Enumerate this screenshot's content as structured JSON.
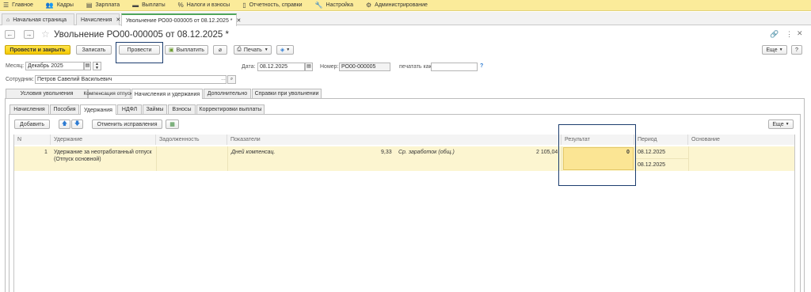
{
  "menu": [
    {
      "icon": "home-icon",
      "glyph": "☰",
      "label": "Главное"
    },
    {
      "icon": "staff-icon",
      "glyph": "👥",
      "label": "Кадры"
    },
    {
      "icon": "salary-icon",
      "glyph": "▤",
      "label": "Зарплата"
    },
    {
      "icon": "payments-icon",
      "glyph": "▬",
      "label": "Выплаты"
    },
    {
      "icon": "percent-icon",
      "glyph": "%",
      "label": "Налоги и взносы"
    },
    {
      "icon": "reports-icon",
      "glyph": "▯",
      "label": "Отчетность, справки"
    },
    {
      "icon": "wrench-icon",
      "glyph": "🔧",
      "label": "Настройка"
    },
    {
      "icon": "gear-icon",
      "glyph": "⚙",
      "label": "Администрирование"
    }
  ],
  "tabs": [
    {
      "label": "Начальная страница",
      "closable": false
    },
    {
      "label": "Начисления",
      "closable": true
    },
    {
      "label": "Увольнение РО00-000005 от 08.12.2025 *",
      "closable": true
    }
  ],
  "document": {
    "title": "Увольнение РО00-000005 от 08.12.2025 *"
  },
  "toolbar": {
    "post_close": "Провести и закрыть",
    "save": "Записать",
    "post": "Провести",
    "pay": "Выплатить",
    "print": "Печать",
    "more": "Еще"
  },
  "form": {
    "month_label": "Месяц:",
    "month_value": "Декабрь 2025",
    "date_label": "Дата:",
    "date_value": "08.12.2025",
    "number_label": "Номер:",
    "number_value": "РО00-000005",
    "print_as_label": "печатать как:",
    "print_as_value": "",
    "employee_label": "Сотрудник:",
    "employee_value": "Петров Савелий Васильевич"
  },
  "tabs_level1": [
    "Условия увольнения",
    "Компенсация отпуска",
    "Начисления и удержания",
    "Дополнительно",
    "Справки при увольнении"
  ],
  "tabs_level2": [
    "Начисления",
    "Пособия",
    "Удержания",
    "НДФЛ",
    "Займы",
    "Взносы",
    "Корректировки выплаты"
  ],
  "grid_toolbar": {
    "add": "Добавить",
    "cancel_fixes": "Отменить исправления",
    "more": "Еще"
  },
  "grid": {
    "columns": [
      "N",
      "Удержание",
      "Задолженность",
      "Показатели",
      "Результат",
      "Период",
      "Основание"
    ],
    "rows": [
      {
        "n": "1",
        "deduction": "Удержание за неотработанный отпуск",
        "deduction_sub": "(Отпуск основной)",
        "debt": "",
        "ind1_name": "Дней компенсац.",
        "ind1_value": "9,33",
        "ind2_name": "Ср. заработок (общ.)",
        "ind2_value": "2 105,04",
        "result": "0",
        "period1": "08.12.2025",
        "period2": "08.12.2025",
        "basis": ""
      }
    ]
  }
}
